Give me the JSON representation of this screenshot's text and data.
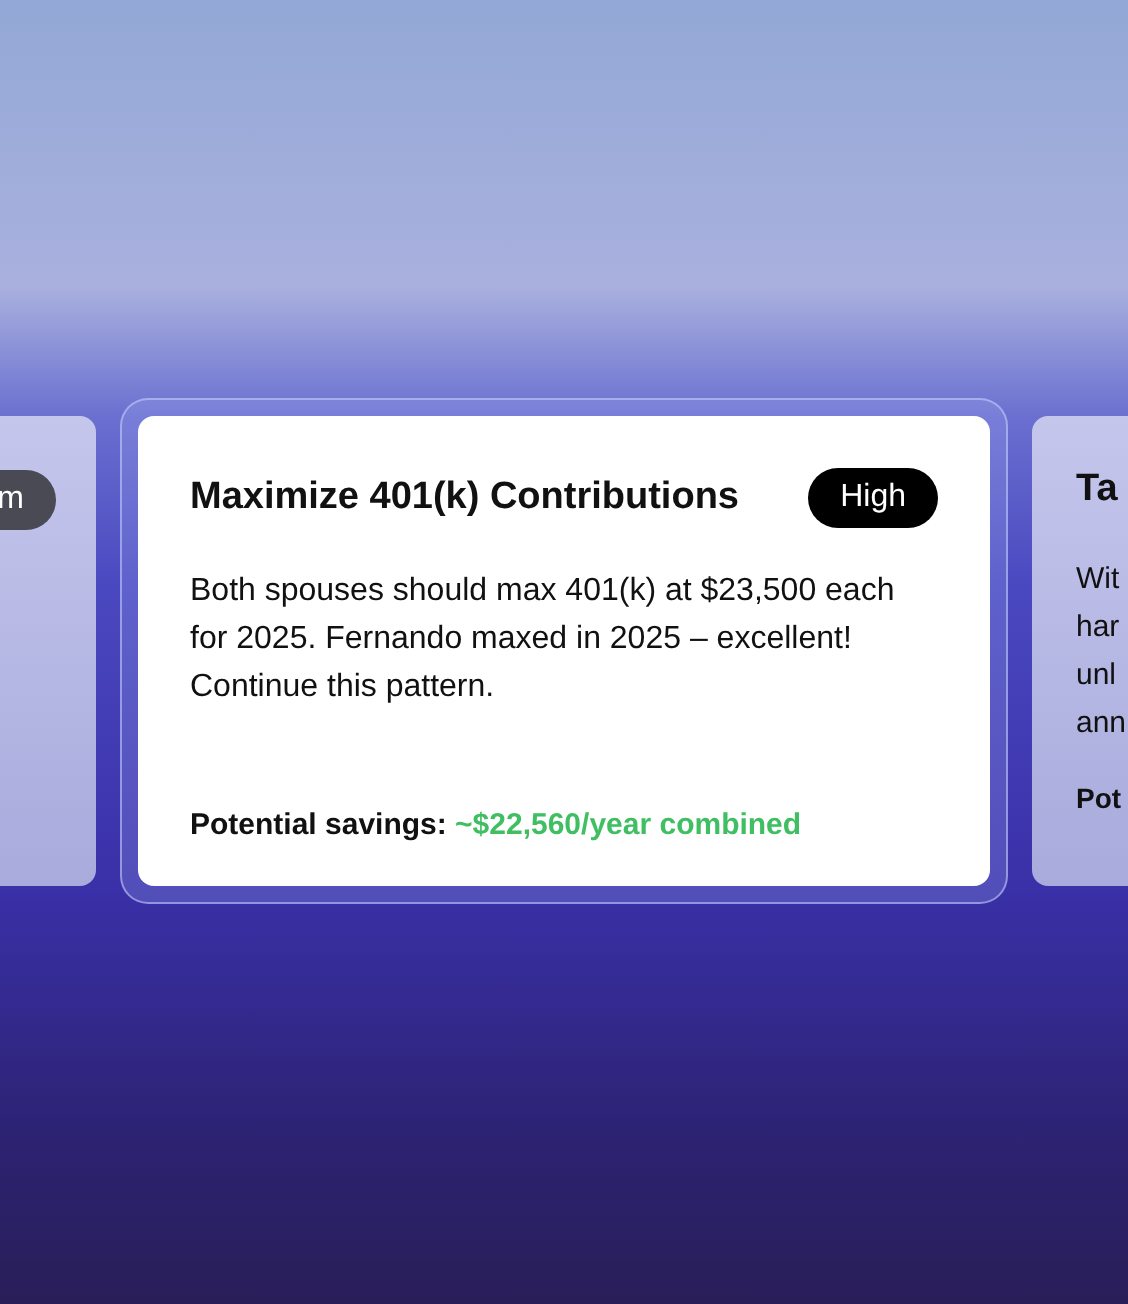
{
  "cards": [
    {
      "kind": "partial",
      "badge": "m"
    },
    {
      "kind": "focused",
      "title": "Maximize 401(k) Contributions",
      "badge": "High",
      "body": "Both spouses should max 401(k) at $23,500 each for 2025. Fernando maxed in 2025 – excellent! Continue this pattern.",
      "savings_label": "Potential savings:",
      "savings_value": "~$22,560/year combined"
    },
    {
      "kind": "preview",
      "title": "Ta",
      "body_lines": [
        "Wit",
        "har",
        "unl",
        "ann"
      ],
      "savings_label": "Pot"
    }
  ]
}
